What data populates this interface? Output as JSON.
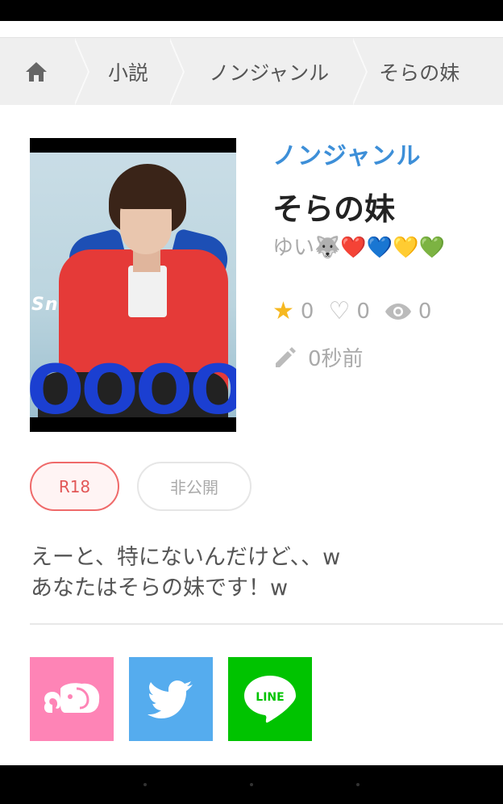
{
  "breadcrumb": {
    "items": [
      "小説",
      "ノンジャンル",
      "そらの妹"
    ]
  },
  "cover": {
    "logo_text": "Sn",
    "big_text": "OΟΟΟ"
  },
  "book": {
    "genre": "ノンジャンル",
    "title": "そらの妹",
    "author": "ゆい🐺❤️💙💛💚"
  },
  "stats": {
    "stars": "0",
    "likes": "0",
    "views": "0",
    "updated": "0秒前"
  },
  "tags": {
    "r18": "R18",
    "private": "非公開"
  },
  "description": {
    "line1": "えーと、特にないんだけど、、w",
    "line2": "あなたはそらの妹です！w"
  },
  "share": {
    "line_label": "LINE"
  },
  "colors": {
    "genre": "#3d8fd8",
    "r18": "#e25757",
    "elephant": "#fe84b6",
    "twitter": "#55acee",
    "line": "#00c300"
  },
  "icons": [
    "home-icon",
    "star-icon",
    "heart-icon",
    "eye-icon",
    "pencil-icon",
    "elephant-icon",
    "twitter-bird-icon",
    "line-icon"
  ]
}
